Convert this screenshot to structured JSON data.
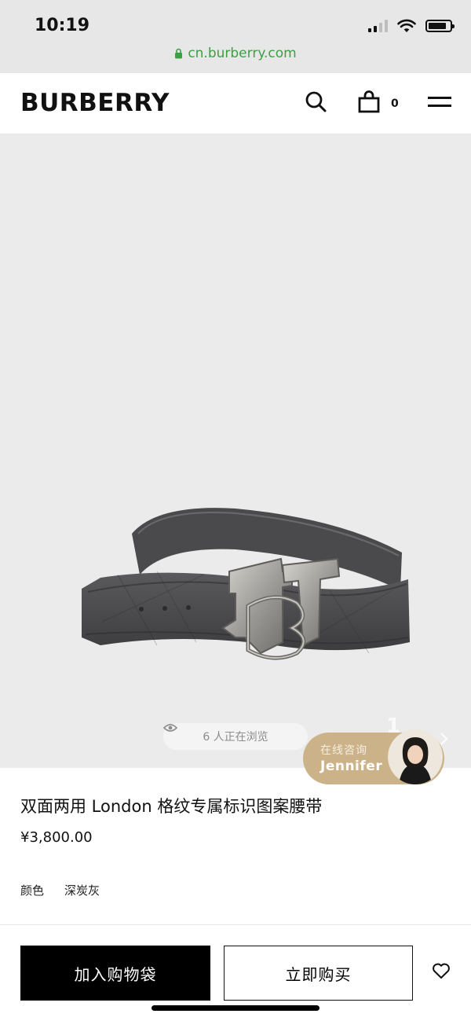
{
  "status_bar": {
    "time": "10:19",
    "icons": [
      "signal-icon",
      "wifi-icon",
      "battery-icon"
    ]
  },
  "browser": {
    "url": "cn.burberry.com",
    "lock_icon": "lock-icon",
    "url_color": "#3aa044"
  },
  "header": {
    "logo": "BURBERRY",
    "search_icon": "search-icon",
    "bag_icon": "bag-icon",
    "bag_count": "0",
    "menu_icon": "menu-icon"
  },
  "gallery": {
    "viewers_text": "6 人正在浏览",
    "eye_icon": "eye-icon",
    "page_indicator": "1",
    "next_icon": "chevron-right-icon"
  },
  "chat": {
    "title": "在线咨询",
    "name": "Jennifer",
    "bubble_color": "#ccb288"
  },
  "product": {
    "title": "双面两用 London 格纹专属标识图案腰带",
    "price": "¥3,800.00",
    "color_label": "颜色",
    "color_value": "深炭灰"
  },
  "actions": {
    "add_to_bag": "加入购物袋",
    "buy_now": "立即购买",
    "wishlist_icon": "heart-icon"
  }
}
